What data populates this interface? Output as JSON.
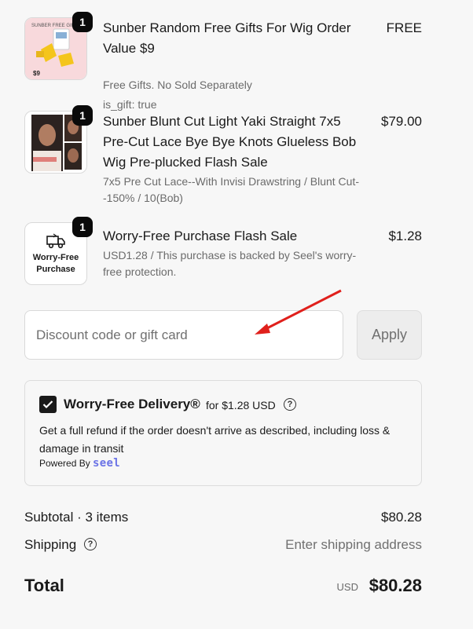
{
  "items": [
    {
      "qty": "1",
      "title": "Sunber Random Free Gifts For Wig Order Value $9",
      "subtitle": "Free Gifts. No Sold Separately",
      "extra": "is_gift: true",
      "price": "FREE",
      "thumb_label": "SUNBER FREE GIFTS",
      "thumb_price": "$9"
    },
    {
      "qty": "1",
      "title": "Sunber Blunt Cut Light Yaki Straight 7x5 Pre-Cut Lace Bye Bye Knots Glueless Bob Wig Pre-plucked Flash Sale",
      "subtitle": "7x5 Pre Cut Lace--With Invisi Drawstring / Blunt Cut--150% / 10(Bob)",
      "price": "$79.00"
    },
    {
      "qty": "1",
      "title": "Worry-Free Purchase Flash Sale",
      "subtitle": "USD1.28 / This purchase is backed by Seel's worry-free protection.",
      "price": "$1.28",
      "thumb_text": "Worry-Free Purchase"
    }
  ],
  "discount": {
    "placeholder": "Discount code or gift card",
    "apply_label": "Apply"
  },
  "worry_free": {
    "title": "Worry-Free Delivery®",
    "for_text": "for $1.28 USD",
    "help": "?",
    "description": "Get a full refund if the order doesn't arrive as described, including loss & damage in transit",
    "powered_by": "Powered By",
    "brand": "seel",
    "checked": true
  },
  "summary": {
    "subtotal_label": "Subtotal · 3 items",
    "subtotal_value": "$80.28",
    "shipping_label": "Shipping",
    "shipping_help": "?",
    "shipping_value": "Enter shipping address",
    "total_label": "Total",
    "total_currency": "USD",
    "total_value": "$80.28"
  },
  "colors": {
    "accent": "#1a1a1a",
    "seel_brand": "#6b73e6",
    "annotation_arrow": "#e0201c"
  }
}
